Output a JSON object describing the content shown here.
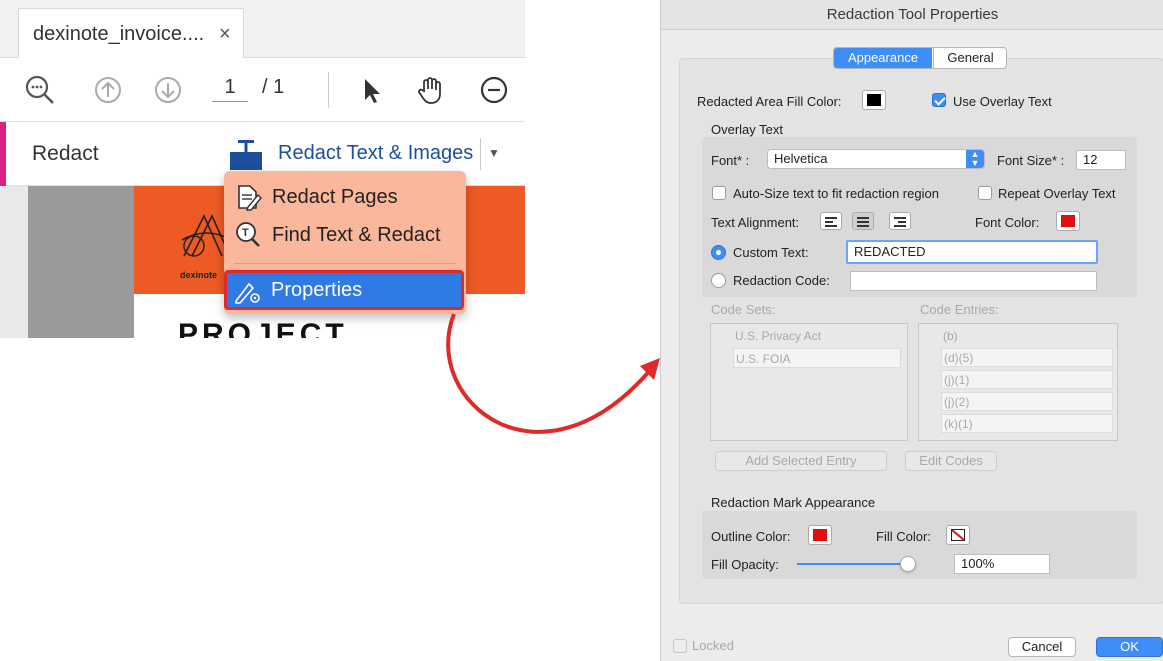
{
  "acrobat": {
    "tab": {
      "title": "dexinote_invoice....",
      "close": "×"
    },
    "toolbar": {
      "icons": [
        "zoom-out-icon",
        "page-up-icon",
        "page-down-icon",
        "select-cursor-icon",
        "hand-tool-icon",
        "zoom-minus-icon"
      ],
      "page_current": "1",
      "page_total": "/ 1"
    },
    "redact_bar": {
      "label": "Redact",
      "tool_label": "Redact Text & Images",
      "dropdown": "▼",
      "accent_color": "#d7227f"
    },
    "menu": {
      "items": [
        {
          "label": "Redact Pages",
          "icon": "redact-pages-icon"
        },
        {
          "label": "Find Text & Redact",
          "icon": "find-text-icon"
        },
        {
          "label": "Properties",
          "icon": "properties-icon",
          "selected": true
        }
      ],
      "highlight_color": "#e02a2a"
    },
    "document": {
      "logo_text": "dexinote",
      "heading": "PROJECT",
      "banner_color": "#ee5a24"
    }
  },
  "dialog": {
    "title": "Redaction Tool Properties",
    "tabs": [
      "Appearance",
      "General"
    ],
    "active_tab": "Appearance",
    "fill_color_label": "Redacted Area Fill Color:",
    "fill_color": "#000000",
    "use_overlay_label": "Use Overlay Text",
    "use_overlay_checked": true,
    "overlay_section_title": "Overlay Text",
    "font_label": "Font* :",
    "font_value": "Helvetica",
    "font_size_label": "Font Size* :",
    "font_size_value": "12",
    "autosize_label": "Auto-Size text to fit redaction region",
    "repeat_label": "Repeat Overlay Text",
    "alignment_label": "Text Alignment:",
    "font_color_label": "Font Color:",
    "font_color": "#e01010",
    "custom_text_label": "Custom Text:",
    "custom_text_value": "REDACTED",
    "redaction_code_label": "Redaction Code:",
    "code_sets_label": "Code Sets:",
    "code_entries_label": "Code Entries:",
    "code_sets": [
      "U.S. Privacy Act",
      "U.S. FOIA"
    ],
    "code_entries": [
      "(b)",
      "(d)(5)",
      "(j)(1)",
      "(j)(2)",
      "(k)(1)"
    ],
    "add_entry_button": "Add Selected Entry",
    "edit_codes_button": "Edit Codes",
    "mark_section_title": "Redaction Mark Appearance",
    "outline_color_label": "Outline Color:",
    "outline_color": "#e01010",
    "fill_color2_label": "Fill Color:",
    "fill_opacity_label": "Fill Opacity:",
    "fill_opacity_value": "100%",
    "fill_opacity_fraction": 1.0,
    "locked_label": "Locked",
    "cancel_button": "Cancel",
    "ok_button": "OK",
    "accent_color": "#3f8ef5"
  }
}
